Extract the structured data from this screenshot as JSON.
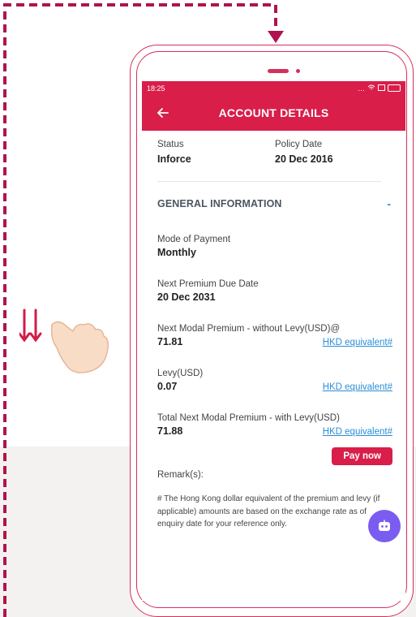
{
  "status_bar": {
    "time": "18:25",
    "icons": [
      "more-icon",
      "wifi-icon",
      "sim-icon",
      "battery-icon"
    ]
  },
  "app_bar": {
    "title": "ACCOUNT DETAILS",
    "back_icon": "back-arrow-icon"
  },
  "summary": {
    "status_label": "Status",
    "status_value": "Inforce",
    "policy_date_label": "Policy Date",
    "policy_date_value": "20 Dec 2016"
  },
  "general": {
    "title": "GENERAL INFORMATION",
    "collapse_symbol": "-",
    "fields": [
      {
        "label": "Mode of Payment",
        "value": "Monthly",
        "link": ""
      },
      {
        "label": "Next Premium Due Date",
        "value": "20 Dec 2031",
        "link": ""
      },
      {
        "label": "Next Modal Premium - without Levy(USD)@",
        "value": "71.81",
        "link": "HKD equivalent#"
      },
      {
        "label": "Levy(USD)",
        "value": "0.07",
        "link": "HKD equivalent#"
      },
      {
        "label": "Total Next Modal Premium - with Levy(USD)",
        "value": "71.88",
        "link": "HKD equivalent#"
      }
    ]
  },
  "pay_button": "Pay now",
  "remark": {
    "title": "Remark(s):",
    "text": "# The Hong Kong dollar equivalent of the premium and levy (if applicable) amounts are based on the exchange rate as of enquiry date for your reference only."
  },
  "chatbot_icon": "chatbot-icon",
  "colors": {
    "brand": "#d91e4a",
    "link": "#2a8fd6",
    "chatbot": "#7b5cf0",
    "dash": "#b0134f"
  }
}
